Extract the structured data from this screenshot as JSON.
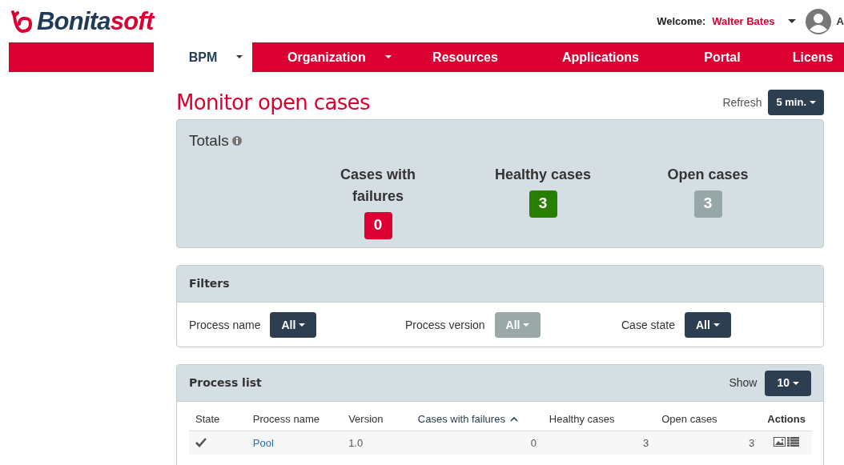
{
  "brand": {
    "name": "Bonita",
    "suffix": "soft"
  },
  "user": {
    "welcome": "Welcome:",
    "name": "Walter Bates",
    "cut_label": "A"
  },
  "nav": [
    {
      "label": "BPM",
      "selected": true,
      "dropdown": true
    },
    {
      "label": "Organization",
      "selected": false,
      "dropdown": true
    },
    {
      "label": "Resources",
      "selected": false,
      "dropdown": false
    },
    {
      "label": "Applications",
      "selected": false,
      "dropdown": false
    },
    {
      "label": "Portal",
      "selected": false,
      "dropdown": false
    },
    {
      "label": "Licens",
      "selected": false,
      "dropdown": false
    }
  ],
  "page_title": "Monitor open cases",
  "refresh": {
    "label": "Refresh",
    "value": "5 min."
  },
  "totals": {
    "title": "Totals",
    "items": [
      {
        "label": "Cases with failures",
        "count": "0",
        "color": "#dc0032"
      },
      {
        "label": "Healthy cases",
        "count": "3",
        "color": "#287e00"
      },
      {
        "label": "Open cases",
        "count": "3",
        "color": "#97a6a6"
      }
    ]
  },
  "filters": {
    "title": "Filters",
    "items": [
      {
        "label": "Process name",
        "value": "All",
        "disabled": false
      },
      {
        "label": "Process version",
        "value": "All",
        "disabled": true
      },
      {
        "label": "Case state",
        "value": "All",
        "disabled": false
      }
    ]
  },
  "process_list": {
    "title": "Process list",
    "show_label": "Show",
    "show_value": "10",
    "columns": [
      {
        "label": "State",
        "sorted": false,
        "bold": false
      },
      {
        "label": "Process name",
        "sorted": false,
        "bold": false
      },
      {
        "label": "Version",
        "sorted": false,
        "bold": false
      },
      {
        "label": "Cases with failures",
        "sorted": true,
        "bold": false
      },
      {
        "label": "Healthy cases",
        "sorted": false,
        "bold": false
      },
      {
        "label": "Open cases",
        "sorted": false,
        "bold": false
      },
      {
        "label": "Actions",
        "sorted": false,
        "bold": true
      }
    ],
    "rows": [
      {
        "name": "Pool",
        "version": "1.0",
        "failures": "0",
        "healthy": "3",
        "open": "3"
      }
    ]
  }
}
